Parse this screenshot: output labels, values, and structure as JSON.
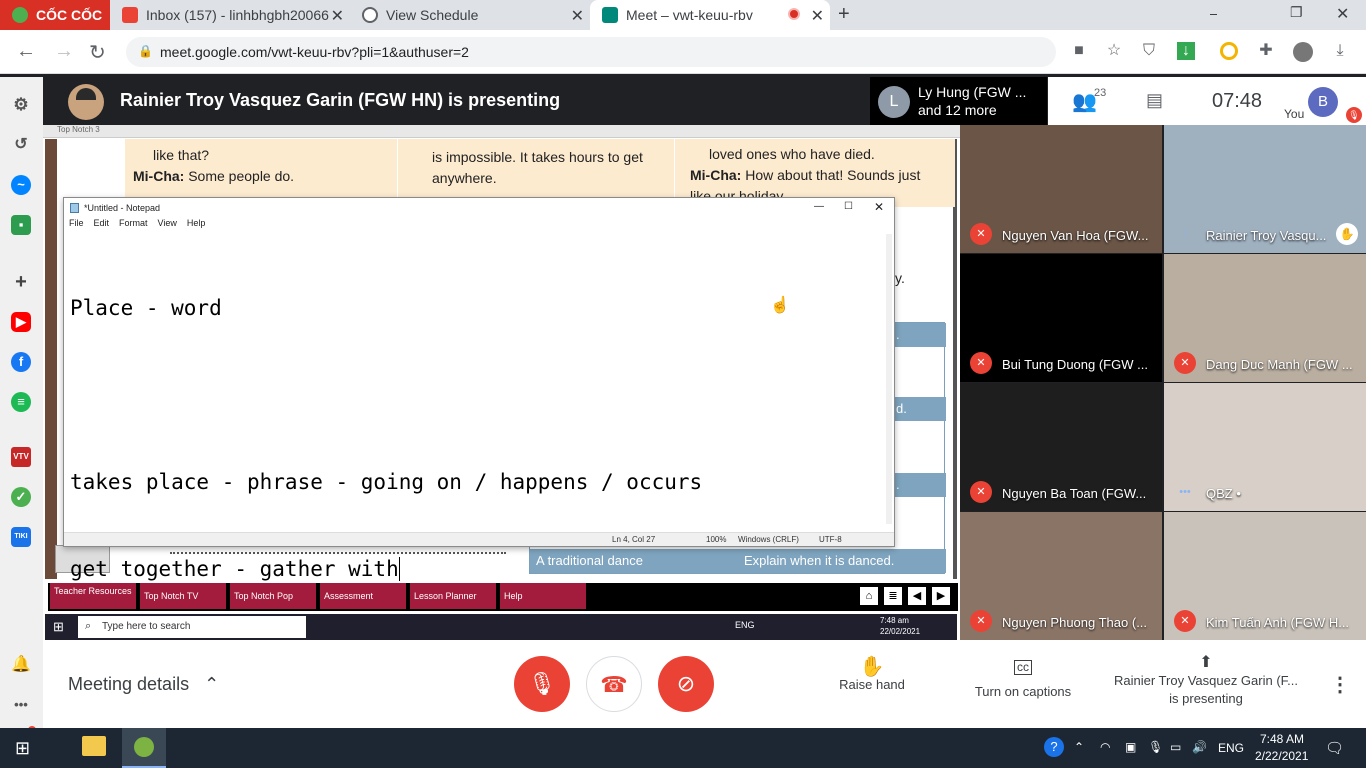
{
  "browser": {
    "tabs": [
      {
        "label": "CỐC CỐC",
        "color": "#d93025"
      },
      {
        "label": "Inbox (157) - linhbhgbh20066",
        "color": "#ea4335"
      },
      {
        "label": "View Schedule",
        "color": "#5f6368"
      },
      {
        "label": "Meet – vwt-keuu-rbv",
        "color": "#00897b"
      }
    ],
    "new_tab": "+",
    "url": "meet.google.com/vwt-keuu-rbv?pli=1&authuser=2"
  },
  "meet": {
    "presenter_title": "Rainier Troy Vasquez Garin (FGW HN) is presenting",
    "participant_preview": {
      "initial": "L",
      "line1": "Ly Hung (FGW ...",
      "line2": "and 12 more"
    },
    "people_count": "23",
    "time": "07:48",
    "self_label": "You",
    "self_initial": "B",
    "participants": [
      {
        "name": "Nguyen Van Hoa (FGW...",
        "bg": "#6a5546"
      },
      {
        "name": "Rainier Troy Vasqu...",
        "bg": "#9fb0bf"
      },
      {
        "name": "Bui Tung Duong (FGW ...",
        "bg": "#000000"
      },
      {
        "name": "Dang Duc Manh (FGW ...",
        "bg": "#b9aea0"
      },
      {
        "name": "Nguyen Ba Toan (FGW...",
        "bg": "#1e1e1e"
      },
      {
        "name": "QBZ •",
        "bg": "#d8d0c8"
      },
      {
        "name": "Nguyen Phuong Thao (...",
        "bg": "#8a7466"
      },
      {
        "name": "Kim Tuấn Anh (FGW H...",
        "bg": "#c9c2ba"
      }
    ],
    "meeting_details": "Meeting details",
    "raise_hand": "Raise hand",
    "captions": "Turn on captions",
    "presenting_line1": "Rainier Troy Vasquez Garin (F...",
    "presenting_line2": "is presenting"
  },
  "slide": {
    "window_title": "Top Notch 3",
    "cells": [
      {
        "text": "like that?"
      },
      {
        "speaker": "Mi-Cha:",
        "text": "Some people do."
      },
      {
        "text": "is impossible. It takes hours to get anywhere."
      },
      {
        "text": "loved ones who have died."
      },
      {
        "speaker": "Mi-Cha:",
        "text": "How about that! Sounds just like our holiday."
      }
    ],
    "side_text": "y.",
    "strip1": ".",
    "strip2": "d.",
    "strip3": ".",
    "bottom_left": "A traditional dance",
    "bottom_right": "Explain when it is danced.",
    "menu": [
      "Teacher Resources",
      "Top Notch TV",
      "Top Notch Pop",
      "Assessment",
      "Lesson Planner",
      "Help"
    ]
  },
  "notepad": {
    "title": "*Untitled - Notepad",
    "menu": [
      "File",
      "Edit",
      "Format",
      "View",
      "Help"
    ],
    "lines": [
      "Place - word",
      "",
      "takes place - phrase - going on / happens / occurs",
      "get together - gather with"
    ],
    "status": {
      "pos": "Ln 4, Col 27",
      "zoom": "100%",
      "eol": "Windows (CRLF)",
      "enc": "UTF-8"
    }
  },
  "inner_taskbar": {
    "search": "Type here to search",
    "lang": "ENG",
    "time": "7:48 am",
    "date": "22/02/2021"
  },
  "taskbar": {
    "lang": "ENG",
    "time": "7:48 AM",
    "date": "2/22/2021"
  }
}
